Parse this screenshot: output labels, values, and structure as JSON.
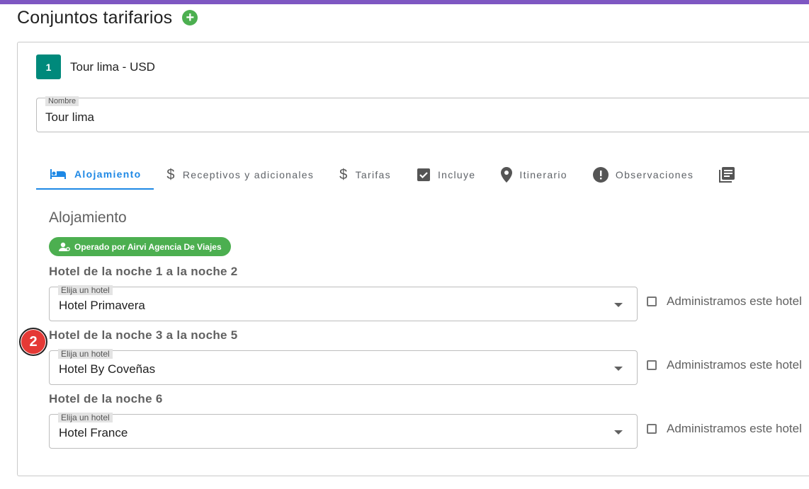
{
  "header": {
    "title": "Conjuntos tarifarios",
    "add_icon": "plus-circle-icon"
  },
  "set": {
    "number": "1",
    "title": "Tour lima - USD",
    "name_label": "Nombre",
    "name_value": "Tour lima"
  },
  "tabs": [
    {
      "label": "Alojamiento",
      "icon": "bed-icon",
      "active": true
    },
    {
      "label": "Receptivos y adicionales",
      "icon": "dollar-icon"
    },
    {
      "label": "Tarifas",
      "icon": "dollar-icon"
    },
    {
      "label": "Incluye",
      "icon": "checkbox-checked-icon"
    },
    {
      "label": "Itinerario",
      "icon": "location-pin-icon"
    },
    {
      "label": "Observaciones",
      "icon": "exclamation-circle-icon"
    },
    {
      "label": "",
      "icon": "library-books-icon"
    }
  ],
  "section": {
    "title": "Alojamiento",
    "operator_chip": "Operado por Airvi Agencia De Viajes"
  },
  "hotels": [
    {
      "night_label": "Hotel de la noche 1 a la noche 2",
      "select_label": "Elija un hotel",
      "value": "Hotel Primavera",
      "check_label": "Administramos este hotel"
    },
    {
      "night_label": "Hotel de la noche 3 a la noche 5",
      "select_label": "Elija un hotel",
      "value": "Hotel By Coveñas",
      "check_label": "Administramos este hotel"
    },
    {
      "night_label": "Hotel de la noche 6",
      "select_label": "Elija un hotel",
      "value": "Hotel France",
      "check_label": "Administramos este hotel"
    }
  ],
  "annotation": {
    "step": "2"
  },
  "colors": {
    "accent": "#1e88e5",
    "success": "#4caf50",
    "badge": "#00897b",
    "topbar": "#7e57c2",
    "marker": "#e53935"
  }
}
